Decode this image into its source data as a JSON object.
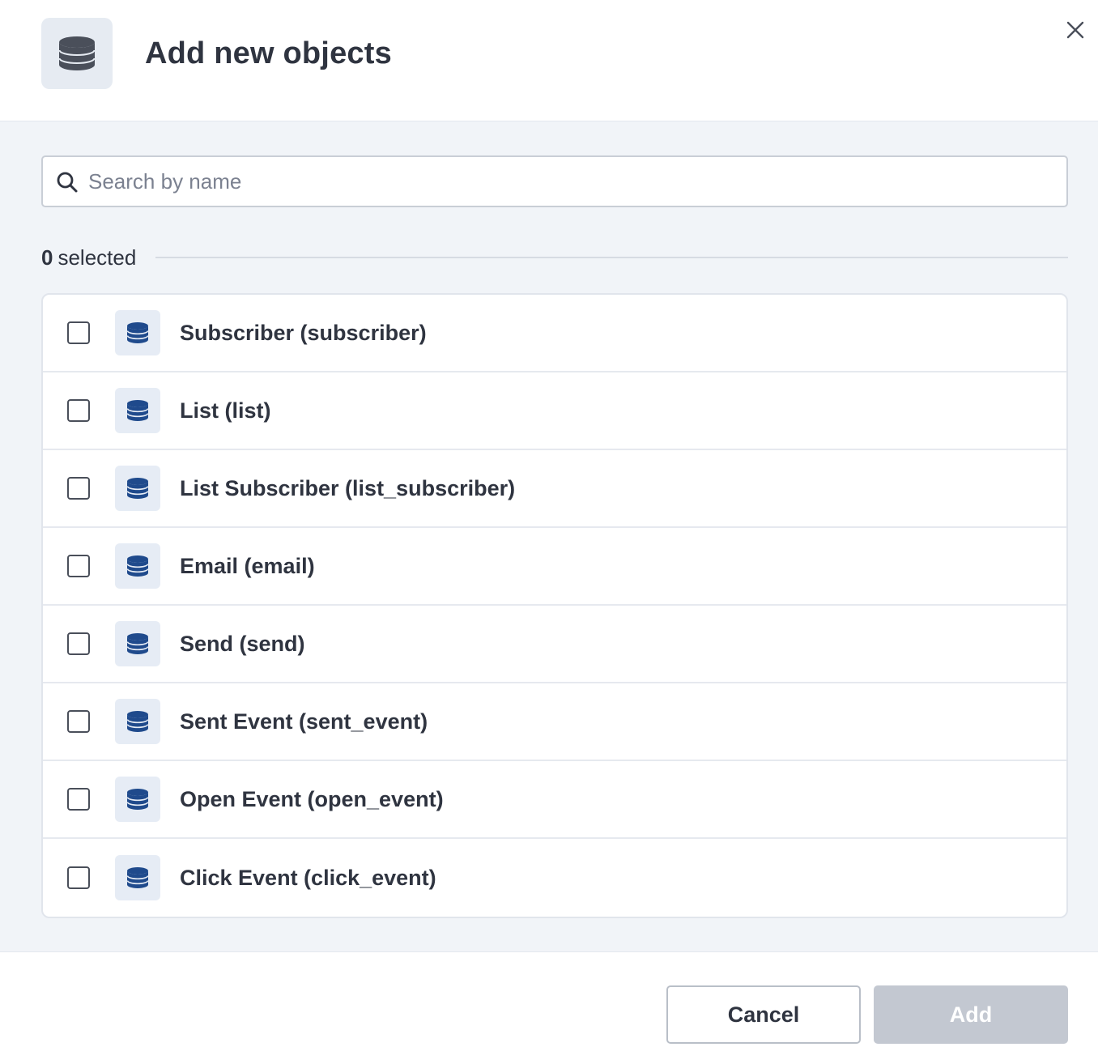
{
  "dialog": {
    "title": "Add new objects",
    "header_icon": "database-icon",
    "close_icon": "close-icon"
  },
  "search": {
    "placeholder": "Search by name",
    "value": ""
  },
  "selection": {
    "count": "0",
    "label": "selected"
  },
  "items": [
    {
      "label": "Subscriber (subscriber)",
      "checked": false
    },
    {
      "label": "List (list)",
      "checked": false
    },
    {
      "label": "List Subscriber (list_subscriber)",
      "checked": false
    },
    {
      "label": "Email (email)",
      "checked": false
    },
    {
      "label": "Send (send)",
      "checked": false
    },
    {
      "label": "Sent Event (sent_event)",
      "checked": false
    },
    {
      "label": "Open Event (open_event)",
      "checked": false
    },
    {
      "label": "Click Event (click_event)",
      "checked": false
    }
  ],
  "footer": {
    "cancel_label": "Cancel",
    "add_label": "Add"
  },
  "colors": {
    "accent": "#1f4a8c",
    "icon_gray": "#4a4f5a",
    "disabled_button": "#c3c8d1",
    "panel_background": "#f1f4f8"
  }
}
